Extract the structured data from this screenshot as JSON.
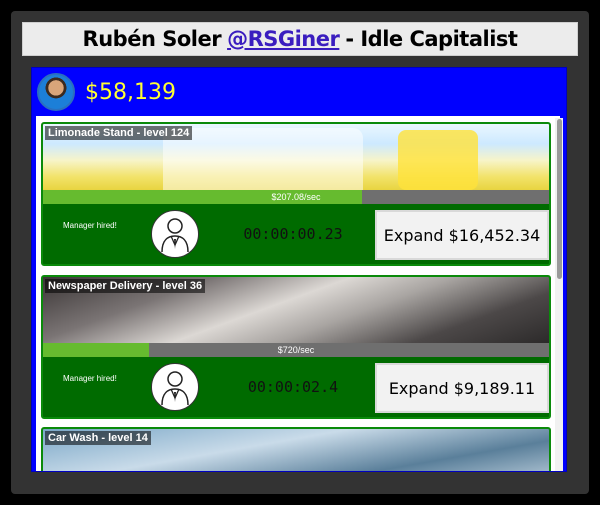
{
  "title": {
    "prefix": "Rubén Soler",
    "handle": "@RSGiner",
    "suffix": "- Idle Capitalist"
  },
  "header": {
    "money": "$58,139"
  },
  "businesses": [
    {
      "name": "Limonade Stand - level 124",
      "rate": "$207.08/sec",
      "progress": 0.63,
      "manager": "Manager hired!",
      "timer": "00:00:00.23",
      "expand": "Expand $16,452.34"
    },
    {
      "name": "Newspaper Delivery - level 36",
      "rate": "$720/sec",
      "progress": 0.21,
      "manager": "Manager hired!",
      "timer": "00:00:02.4",
      "expand": "Expand $9,189.11"
    },
    {
      "name": "Car Wash - level 14"
    }
  ]
}
